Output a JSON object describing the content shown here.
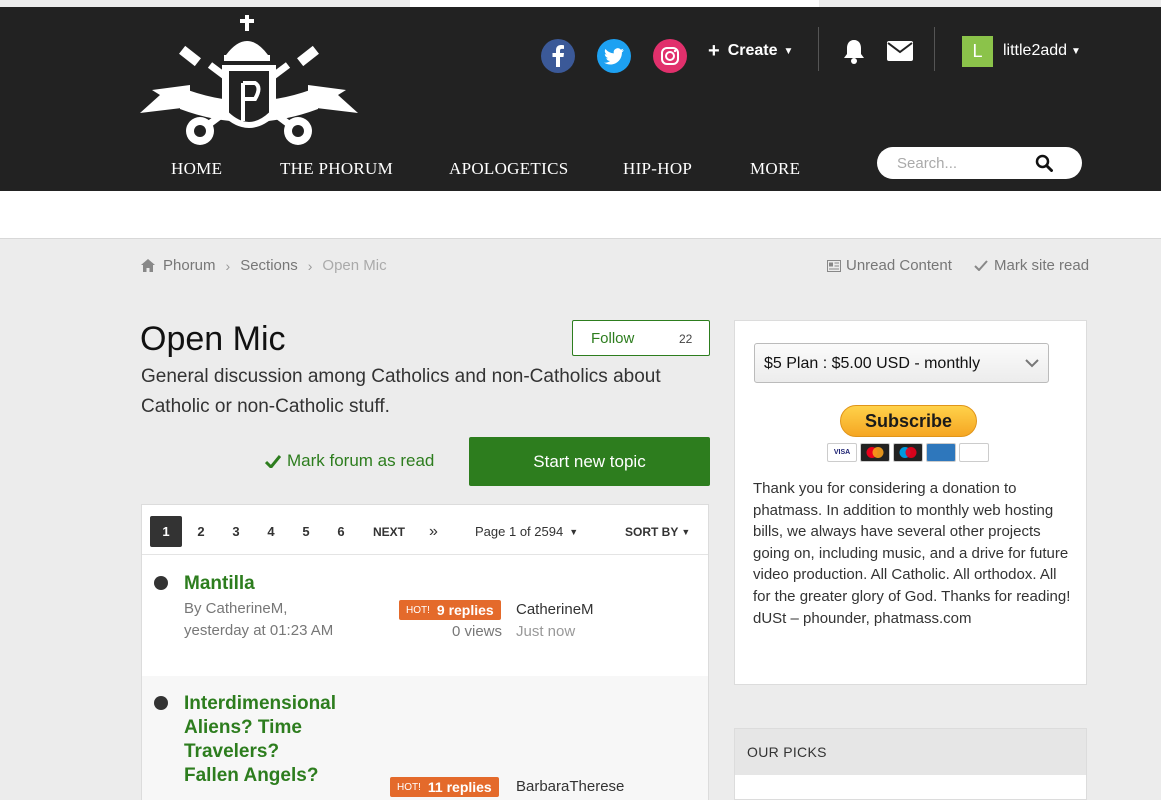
{
  "header": {
    "create_label": "Create",
    "avatar_letter": "L",
    "username": "little2add",
    "nav": [
      "HOME",
      "THE PHORUM",
      "APOLOGETICS",
      "HIP-HOP",
      "MORE"
    ],
    "search_placeholder": "Search...",
    "social": [
      "facebook-icon",
      "twitter-icon",
      "instagram-icon"
    ]
  },
  "breadcrumb": {
    "items": [
      "Phorum",
      "Sections",
      "Open Mic"
    ],
    "unread_content": "Unread Content",
    "mark_site_read": "Mark site read"
  },
  "forum": {
    "title": "Open Mic",
    "follow_label": "Follow",
    "follow_count": "22",
    "description": "General discussion among Catholics and non-Catholics about Catholic or non-Catholic stuff.",
    "mark_forum_read": "Mark forum as read",
    "start_new_topic": "Start new topic"
  },
  "pagination": {
    "pages": [
      "1",
      "2",
      "3",
      "4",
      "5",
      "6"
    ],
    "current": "1",
    "next": "NEXT",
    "last": "»",
    "page_of": "Page 1 of 2594",
    "sort_by": "SORT BY"
  },
  "topics": [
    {
      "title": "Mantilla",
      "meta": "By CatherineM, yesterday at 01:23 AM",
      "hot": "HOT!",
      "replies": "9 replies",
      "views": "0 views",
      "last_user": "CatherineM",
      "last_time": "Just now"
    },
    {
      "title": "Interdimensional Aliens? Time Travelers? Fallen Angels?",
      "hot": "HOT!",
      "replies": "11 replies",
      "last_user": "BarbaraTherese"
    }
  ],
  "sidebar": {
    "plan": "$5 Plan : $5.00 USD - monthly",
    "subscribe": "Subscribe",
    "cards": [
      "VISA",
      "MC",
      "MAESTRO",
      "AMEX",
      "DISCOVER"
    ],
    "donate_text": "Thank you for considering a donation to phatmass. In addition to monthly web hosting bills, we always have several other projects going on, including music, and a drive for future video production. All Catholic. All orthodox. All for the greater glory of God. Thanks for reading!\ndUSt – phounder, phatmass.com",
    "our_picks": "OUR PICKS"
  },
  "colors": {
    "header_bg": "#222222",
    "accent_green": "#2d7d1e",
    "hot_orange": "#e46a2b",
    "facebook": "#3b5998",
    "twitter": "#1da1f2",
    "instagram": "#e1306c"
  }
}
